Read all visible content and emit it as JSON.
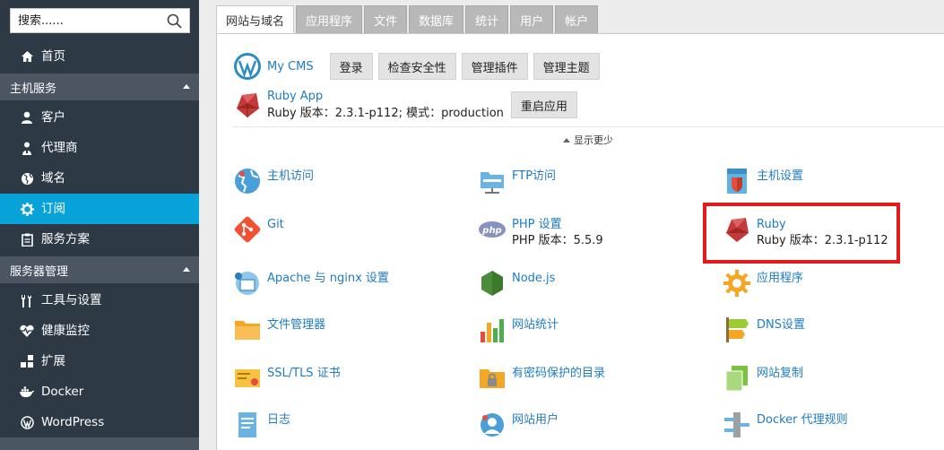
{
  "sidebar": {
    "search": {
      "placeholder": "搜索......",
      "icon": "search-icon"
    },
    "items": [
      {
        "label": "首页",
        "icon": "home-icon"
      },
      {
        "label": "客户",
        "icon": "user-icon"
      },
      {
        "label": "代理商",
        "icon": "reseller-icon"
      },
      {
        "label": "域名",
        "icon": "globe-icon"
      },
      {
        "label": "订阅",
        "icon": "gear-icon"
      },
      {
        "label": "服务方案",
        "icon": "clipboard-icon"
      },
      {
        "label": "工具与设置",
        "icon": "tools-icon"
      },
      {
        "label": "健康监控",
        "icon": "heartbeat-icon"
      },
      {
        "label": "扩展",
        "icon": "extensions-icon"
      },
      {
        "label": "Docker",
        "icon": "docker-icon"
      },
      {
        "label": "WordPress",
        "icon": "wordpress-icon"
      }
    ],
    "sections": [
      {
        "label": "主机服务"
      },
      {
        "label": "服务器管理"
      }
    ],
    "active_item": "订阅",
    "colors": {
      "background": "#2d3944",
      "section": "#4b5662",
      "active": "#07a2d8"
    }
  },
  "tabs": [
    {
      "label": "网站与域名",
      "active": true
    },
    {
      "label": "应用程序"
    },
    {
      "label": "文件"
    },
    {
      "label": "数据库"
    },
    {
      "label": "统计"
    },
    {
      "label": "用户"
    },
    {
      "label": "帐户"
    }
  ],
  "apps": {
    "wordpress": {
      "name": "My CMS",
      "icon": "wordpress-logo-icon",
      "buttons": [
        "登录",
        "检查安全性",
        "管理插件",
        "管理主题"
      ]
    },
    "ruby": {
      "name": "Ruby App",
      "info": "Ruby 版本：2.3.1-p112; 模式：production",
      "icon": "ruby-logo-icon",
      "buttons": [
        "重启应用"
      ]
    },
    "show_less": "显示更少"
  },
  "tools": [
    {
      "label": "主机访问",
      "icon": "hosting-access-icon"
    },
    {
      "label": "FTP访问",
      "icon": "ftp-icon"
    },
    {
      "label": "主机设置",
      "icon": "hosting-settings-icon"
    },
    {
      "label": "Git",
      "icon": "git-icon"
    },
    {
      "label": "PHP 设置",
      "sub": "PHP 版本：5.5.9",
      "icon": "php-icon"
    },
    {
      "label": "Ruby",
      "sub": "Ruby 版本：2.3.1-p112",
      "icon": "ruby-icon",
      "highlighted": true
    },
    {
      "label": "Apache 与 nginx 设置",
      "icon": "apache-nginx-icon"
    },
    {
      "label": "Node.js",
      "icon": "nodejs-icon"
    },
    {
      "label": "应用程序",
      "icon": "applications-icon"
    },
    {
      "label": "文件管理器",
      "icon": "file-manager-icon"
    },
    {
      "label": "网站统计",
      "icon": "statistics-icon"
    },
    {
      "label": "DNS设置",
      "icon": "dns-icon"
    },
    {
      "label": "SSL/TLS 证书",
      "icon": "ssl-certificate-icon"
    },
    {
      "label": "有密码保护的目录",
      "icon": "protected-directory-icon"
    },
    {
      "label": "网站复制",
      "icon": "website-copy-icon"
    },
    {
      "label": "日志",
      "icon": "logs-icon"
    },
    {
      "label": "网站用户",
      "icon": "web-users-icon"
    },
    {
      "label": "Docker 代理规则",
      "icon": "docker-proxy-icon"
    }
  ],
  "colors": {
    "link": "#1e7bc3",
    "highlight": "#e41b1b"
  }
}
